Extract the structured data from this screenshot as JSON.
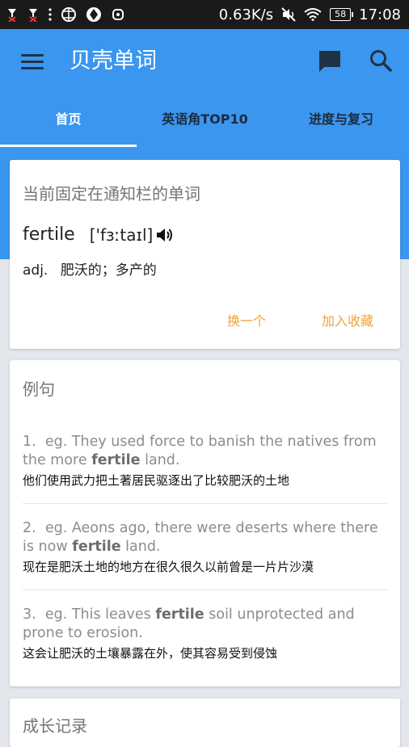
{
  "status_bar": {
    "speed": "0.63K/s",
    "battery": "58",
    "time": "17:08"
  },
  "app_bar": {
    "title": "贝壳单词"
  },
  "tabs": [
    {
      "label": "首页",
      "active": true
    },
    {
      "label": "英语角TOP10",
      "active": false
    },
    {
      "label": "进度与复习",
      "active": false
    }
  ],
  "pinned_card": {
    "title": "当前固定在通知栏的单词",
    "word": "fertile",
    "phonetic": "['fɜːtaɪl]",
    "pos": "adj.",
    "definition": "肥沃的；多产的",
    "actions": {
      "change": "换一个",
      "favorite": "加入收藏"
    }
  },
  "examples_card": {
    "title": "例句",
    "items": [
      {
        "num": "1.",
        "prefix": "eg. They used force to banish the natives from the more ",
        "keyword": "fertile",
        "suffix": " land.",
        "zh": "他们使用武力把土著居民驱逐出了比较肥沃的土地"
      },
      {
        "num": "2.",
        "prefix": "eg. Aeons ago, there were deserts where there is now ",
        "keyword": "fertile",
        "suffix": " land.",
        "zh": "现在是肥沃土地的地方在很久很久以前曾是一片片沙漠"
      },
      {
        "num": "3.",
        "prefix": "eg. This leaves ",
        "keyword": "fertile",
        "suffix": " soil unprotected and prone to erosion.",
        "zh": "这会让肥沃的土壤暴露在外，使其容易受到侵蚀"
      }
    ]
  },
  "growth_card": {
    "title": "成长记录"
  },
  "colors": {
    "primary": "#3b96f0",
    "accent": "#f5a033",
    "background": "#e3e7ec"
  }
}
